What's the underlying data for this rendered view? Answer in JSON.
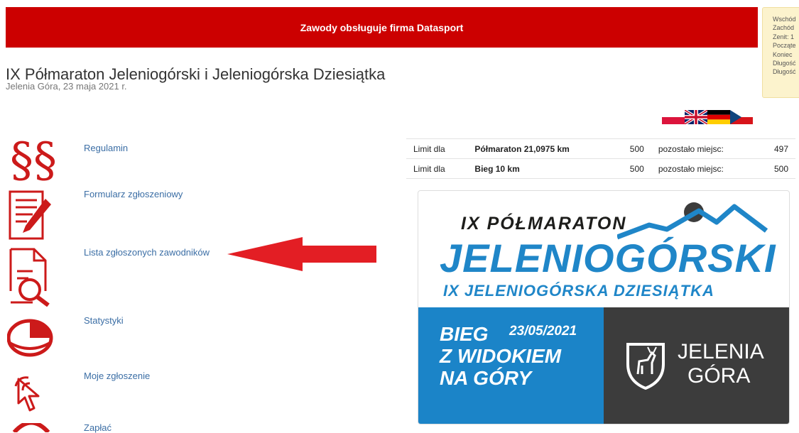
{
  "header": {
    "banner_text": "Zawody obsługuje firma Datasport"
  },
  "sun_info": {
    "lines": [
      "Wschód",
      "Zachód",
      "Zenit: 1",
      "Począte",
      "Koniec",
      "Długość",
      "Długość"
    ]
  },
  "event": {
    "title": "IX Półmaraton Jeleniogórski i Jeleniogórska Dziesiątka",
    "subtitle": "Jelenia Góra, 23 maja 2021 r."
  },
  "languages": [
    "pl-flag-icon",
    "uk-flag-icon",
    "de-flag-icon",
    "cz-flag-icon"
  ],
  "menu": [
    {
      "label": "Regulamin",
      "icon": "section-sign-icon"
    },
    {
      "label": "Formularz zgłoszeniowy",
      "icon": "form-pencil-icon"
    },
    {
      "label": "Lista zgłoszonych zawodników",
      "icon": "document-search-icon"
    },
    {
      "label": "Statystyki",
      "icon": "pie-chart-icon"
    },
    {
      "label": "Moje zgłoszenie",
      "icon": "cursor-click-icon"
    },
    {
      "label": "Zapłać",
      "icon": "payment-icon"
    }
  ],
  "limits": [
    {
      "prefix": "Limit dla",
      "name": "Półmaraton 21,0975 km",
      "limit": "500",
      "remaining_label": "pozostało miejsc:",
      "remaining": "497"
    },
    {
      "prefix": "Limit dla",
      "name": "Bieg 10 km",
      "limit": "500",
      "remaining_label": "pozostało miejsc:",
      "remaining": "500"
    }
  ],
  "poster": {
    "line1": "IX PÓŁMARATON",
    "line2": "JELENIOGÓRSKI",
    "line3": "IX JELENIOGÓRSKA DZIESIĄTKA",
    "bieg": [
      "BIEG",
      "Z WIDOKIEM",
      "NA GÓRY"
    ],
    "date": "23/05/2021",
    "city1": "JELENIA",
    "city2": "GÓRA"
  },
  "colors": {
    "brand_red": "#cc0000",
    "link": "#3b6ea5",
    "poster_blue": "#1b84c8",
    "poster_gray": "#3c3c3c"
  }
}
